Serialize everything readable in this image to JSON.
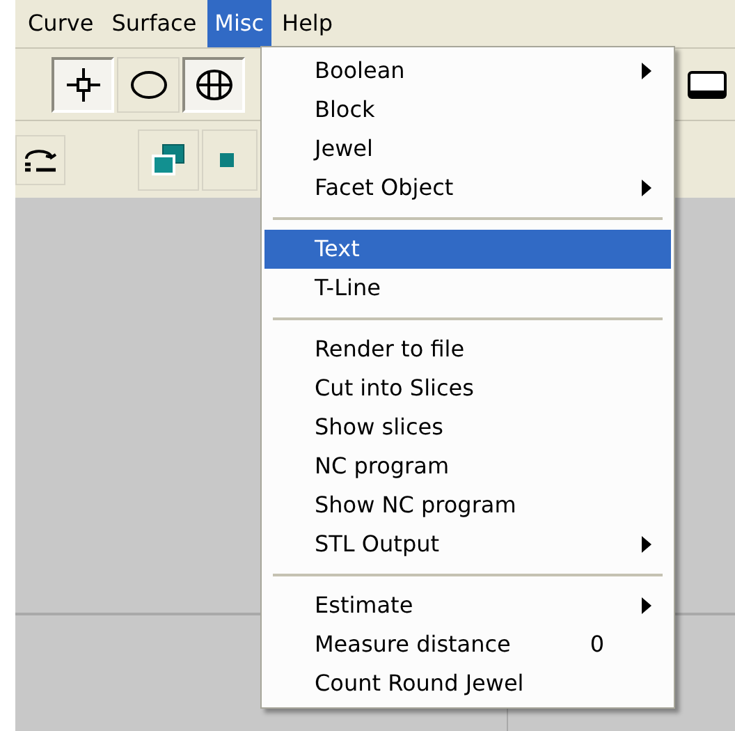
{
  "menu_bar": [
    {
      "label": "Curve",
      "selected": false
    },
    {
      "label": "Surface",
      "selected": false
    },
    {
      "label": "Misc",
      "selected": true
    },
    {
      "label": "Help",
      "selected": false
    }
  ],
  "toolbar": {
    "buttons": [
      {
        "kind": "crosshair",
        "pressed": true
      },
      {
        "kind": "ellipse",
        "pressed": false
      },
      {
        "kind": "crossed-circle",
        "pressed": true
      }
    ]
  },
  "misc_menu": {
    "items": [
      {
        "kind": "item",
        "label": "Boolean",
        "submenu": true,
        "selected": false
      },
      {
        "kind": "item",
        "label": "Block",
        "submenu": false,
        "selected": false
      },
      {
        "kind": "item",
        "label": "Jewel",
        "submenu": false,
        "selected": false
      },
      {
        "kind": "item",
        "label": "Facet Object",
        "submenu": true,
        "selected": false
      },
      {
        "kind": "separator"
      },
      {
        "kind": "item",
        "label": "Text",
        "submenu": false,
        "selected": true
      },
      {
        "kind": "item",
        "label": "T-Line",
        "submenu": false,
        "selected": false
      },
      {
        "kind": "separator"
      },
      {
        "kind": "item",
        "label": "Render to file",
        "submenu": false,
        "selected": false
      },
      {
        "kind": "item",
        "label": "Cut into Slices",
        "submenu": false,
        "selected": false
      },
      {
        "kind": "item",
        "label": "Show slices",
        "submenu": false,
        "selected": false
      },
      {
        "kind": "item",
        "label": "NC program",
        "submenu": false,
        "selected": false
      },
      {
        "kind": "item",
        "label": "Show NC program",
        "submenu": false,
        "selected": false
      },
      {
        "kind": "item",
        "label": "STL Output",
        "submenu": true,
        "selected": false
      },
      {
        "kind": "separator"
      },
      {
        "kind": "item",
        "label": "Estimate",
        "submenu": true,
        "selected": false
      },
      {
        "kind": "item",
        "label": "Measure distance",
        "shortcut": "0",
        "submenu": false,
        "selected": false
      },
      {
        "kind": "item",
        "label": "Count Round Jewel",
        "submenu": false,
        "selected": false
      }
    ]
  }
}
